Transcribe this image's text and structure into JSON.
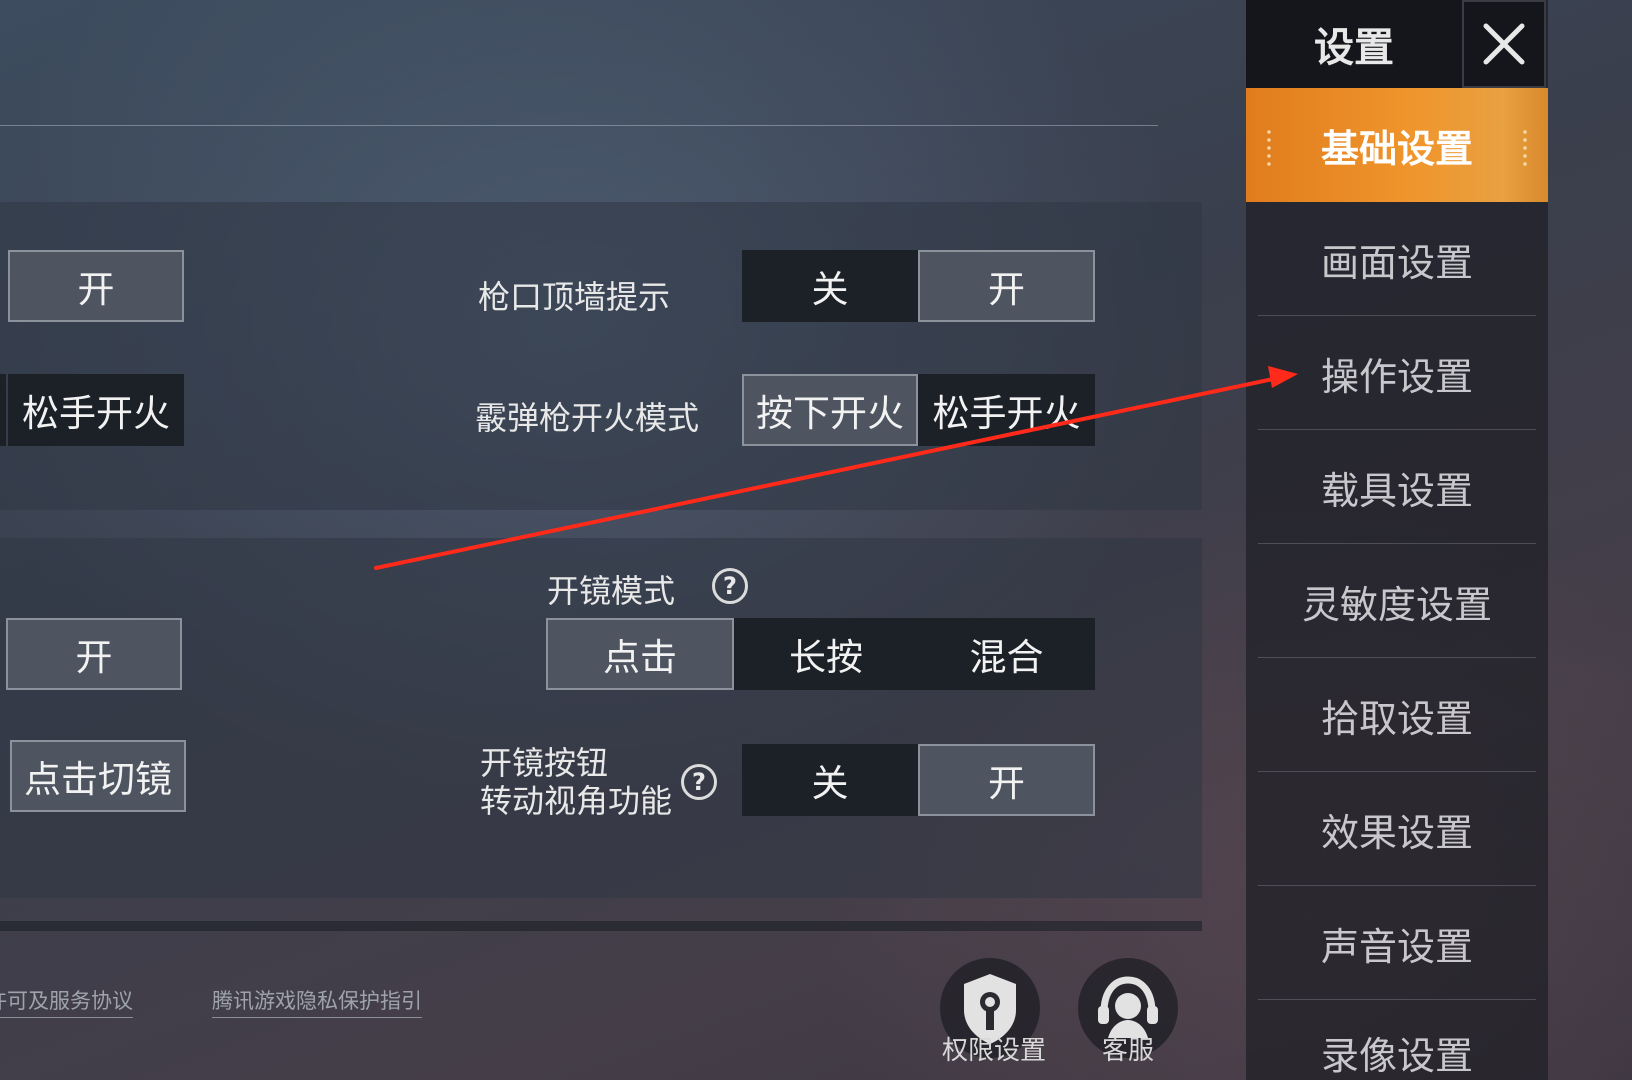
{
  "sidebar": {
    "title": "设置",
    "close_icon": "close-icon",
    "items": [
      {
        "label": "基础设置",
        "active": true
      },
      {
        "label": "画面设置"
      },
      {
        "label": "操作设置"
      },
      {
        "label": "载具设置"
      },
      {
        "label": "灵敏度设置"
      },
      {
        "label": "拾取设置"
      },
      {
        "label": "效果设置"
      },
      {
        "label": "声音设置"
      },
      {
        "label": "录像设置"
      }
    ]
  },
  "section1": {
    "left_row1": {
      "value": "开"
    },
    "left_row2": {
      "value": "松手开火"
    },
    "muzzle_wall": {
      "label": "枪口顶墙提示",
      "options": [
        "关",
        "开"
      ],
      "selected": "开"
    },
    "shotgun_fire": {
      "label": "霰弹枪开火模式",
      "options": [
        "按下开火",
        "松手开火"
      ],
      "selected": "按下开火"
    }
  },
  "section2": {
    "left_row1": {
      "value": "开"
    },
    "left_row2": {
      "value": "点击切镜"
    },
    "scope_mode": {
      "label": "开镜模式",
      "help": "?",
      "options": [
        "点击",
        "长按",
        "混合"
      ],
      "selected": "点击"
    },
    "scope_rotate": {
      "label_line1": "开镜按钮",
      "label_line2": "转动视角功能",
      "help": "?",
      "options": [
        "关",
        "开"
      ],
      "selected": "开"
    }
  },
  "footer": {
    "links": [
      "许可及服务协议",
      "腾讯游戏隐私保护指引"
    ],
    "permission": {
      "label": "权限设置",
      "icon": "shield-key-icon"
    },
    "support": {
      "label": "客服",
      "icon": "headset-icon"
    }
  },
  "colors": {
    "accent": "#f0952c",
    "arrow": "#ff2a1a"
  }
}
